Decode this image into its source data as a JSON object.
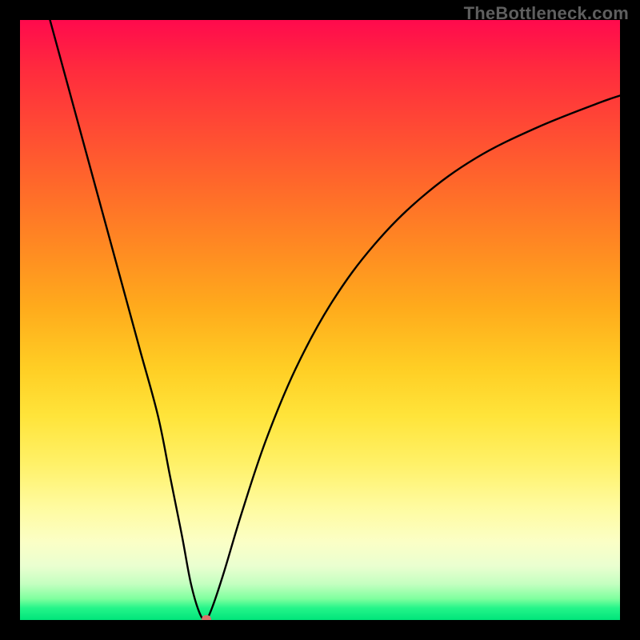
{
  "watermark": "TheBottleneck.com",
  "chart_data": {
    "type": "line",
    "title": "",
    "xlabel": "",
    "ylabel": "",
    "xlim": [
      0,
      100
    ],
    "ylim": [
      0,
      100
    ],
    "grid": false,
    "legend": false,
    "series": [
      {
        "name": "bottleneck-curve",
        "x": [
          5,
          8,
          11,
          14,
          17,
          20,
          23,
          25,
          27,
          28.5,
          30,
          31,
          32,
          34,
          37,
          41,
          46,
          52,
          59,
          67,
          76,
          86,
          96,
          100
        ],
        "y": [
          100,
          89,
          78,
          67,
          56,
          45,
          34,
          24,
          14,
          6,
          1,
          0.2,
          2,
          8,
          18,
          30,
          42,
          53,
          62.5,
          70.5,
          77,
          82,
          86,
          87.4
        ],
        "color": "#000000"
      }
    ],
    "marker": {
      "x": 31,
      "y": 0.2,
      "color": "#d9736b"
    },
    "background_gradient_stops": [
      {
        "pos": 0.0,
        "color": "#ff0a4d"
      },
      {
        "pos": 0.28,
        "color": "#ff6a2a"
      },
      {
        "pos": 0.58,
        "color": "#ffce24"
      },
      {
        "pos": 0.81,
        "color": "#fffb9e"
      },
      {
        "pos": 0.95,
        "color": "#7dff9e"
      },
      {
        "pos": 1.0,
        "color": "#00e47a"
      }
    ]
  }
}
